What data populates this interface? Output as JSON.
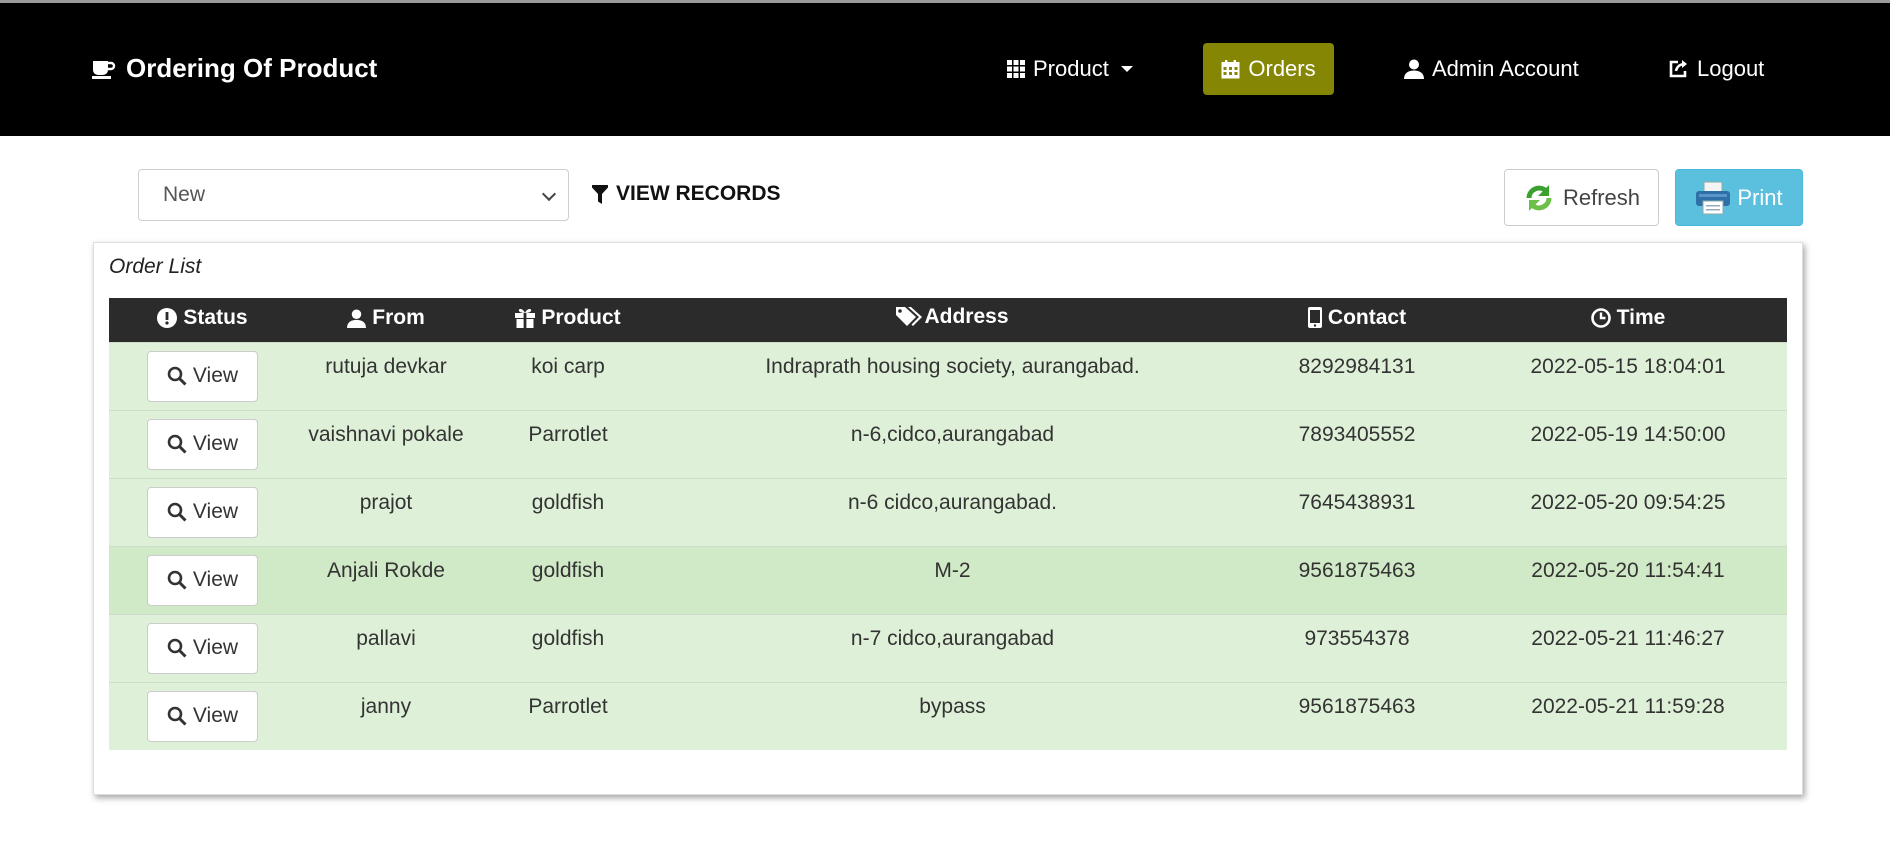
{
  "app": {
    "title": "Ordering Of Product"
  },
  "nav": {
    "product_label": "Product",
    "orders_label": "Orders",
    "admin_label": "Admin Account",
    "logout_label": "Logout"
  },
  "filter": {
    "selected": "New",
    "view_records_label": "VIEW RECORDS"
  },
  "actions": {
    "refresh_label": "Refresh",
    "print_label": "Print"
  },
  "panel": {
    "title": "Order List"
  },
  "table": {
    "headers": {
      "status": "Status",
      "from": "From",
      "product": "Product",
      "address": "Address",
      "contact": "Contact",
      "time": "Time"
    },
    "view_label": "View",
    "rows": [
      {
        "from": "rutuja devkar",
        "product": "koi carp",
        "address": "Indraprath housing society, aurangabad.",
        "contact": "8292984131",
        "time": "2022-05-15 18:04:01"
      },
      {
        "from": "vaishnavi pokale",
        "product": "Parrotlet",
        "address": "n-6,cidco,aurangabad",
        "contact": "7893405552",
        "time": "2022-05-19 14:50:00"
      },
      {
        "from": "prajot",
        "product": "goldfish",
        "address": "n-6 cidco,aurangabad.",
        "contact": "7645438931",
        "time": "2022-05-20 09:54:25"
      },
      {
        "from": "Anjali Rokde",
        "product": "goldfish",
        "address": "M-2",
        "contact": "9561875463",
        "time": "2022-05-20 11:54:41"
      },
      {
        "from": "pallavi",
        "product": "goldfish",
        "address": "n-7 cidco,aurangabad",
        "contact": "973554378",
        "time": "2022-05-21 11:46:27"
      },
      {
        "from": "janny",
        "product": "Parrotlet",
        "address": "bypass",
        "contact": "9561875463",
        "time": "2022-05-21 11:59:28"
      }
    ]
  },
  "colors": {
    "navbar": "#000000",
    "orders_active": "#868605",
    "print_button": "#5bc0de",
    "row_success": "#dff0d8",
    "table_header": "#2b2b2b"
  }
}
